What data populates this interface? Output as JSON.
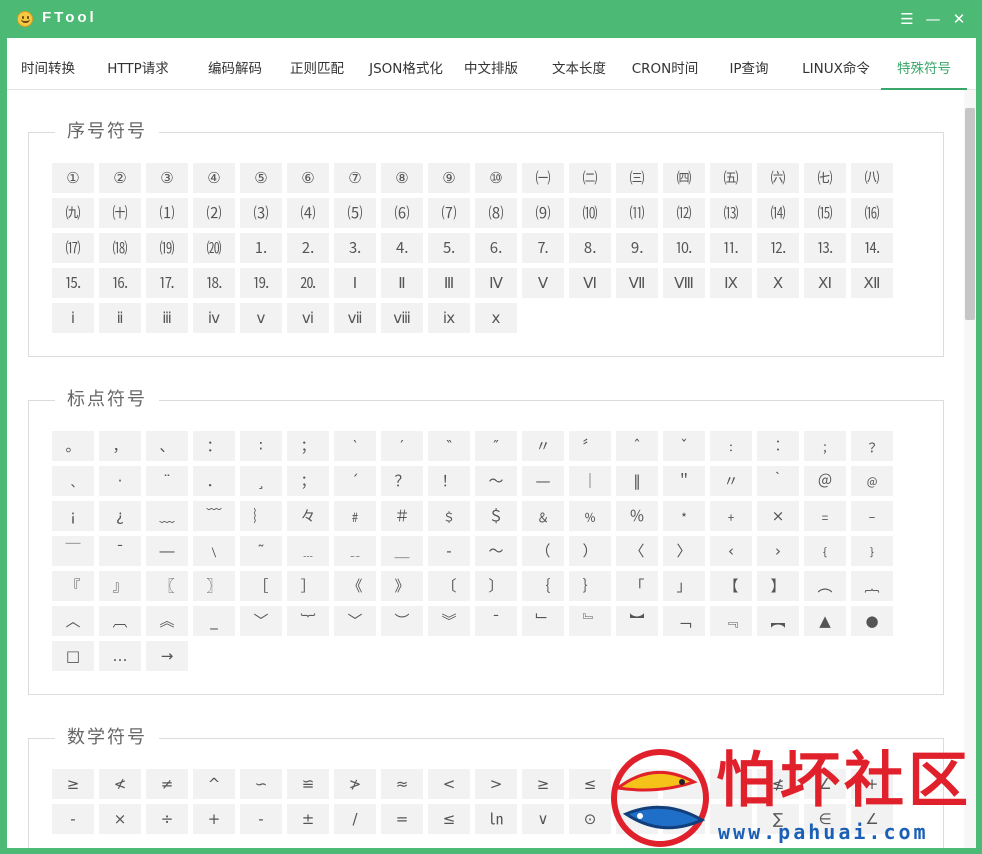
{
  "window": {
    "title": "FTool",
    "menu_icon": "☰",
    "minimize_icon": "—",
    "close_icon": "✕"
  },
  "tabs": [
    {
      "label": "时间转换"
    },
    {
      "label": "HTTP请求"
    },
    {
      "label": "编码解码"
    },
    {
      "label": "正则匹配"
    },
    {
      "label": "JSON格式化"
    },
    {
      "label": "中文排版"
    },
    {
      "label": "文本长度"
    },
    {
      "label": "CRON时间"
    },
    {
      "label": "IP查询"
    },
    {
      "label": "LINUX命令"
    },
    {
      "label": "特殊符号",
      "active": true
    }
  ],
  "sections": [
    {
      "title": "序号符号",
      "symbols": [
        "①",
        "②",
        "③",
        "④",
        "⑤",
        "⑥",
        "⑦",
        "⑧",
        "⑨",
        "⑩",
        "㈠",
        "㈡",
        "㈢",
        "㈣",
        "㈤",
        "㈥",
        "㈦",
        "㈧",
        "㈨",
        "㈩",
        "⑴",
        "⑵",
        "⑶",
        "⑷",
        "⑸",
        "⑹",
        "⑺",
        "⑻",
        "⑼",
        "⑽",
        "⑾",
        "⑿",
        "⒀",
        "⒁",
        "⒂",
        "⒃",
        "⒄",
        "⒅",
        "⒆",
        "⒇",
        "⒈",
        "⒉",
        "⒊",
        "⒋",
        "⒌",
        "⒍",
        "⒎",
        "⒏",
        "⒐",
        "⒑",
        "⒒",
        "⒓",
        "⒔",
        "⒕",
        "⒖",
        "⒗",
        "⒘",
        "⒙",
        "⒚",
        "⒛",
        "Ⅰ",
        "Ⅱ",
        "Ⅲ",
        "Ⅳ",
        "Ⅴ",
        "Ⅵ",
        "Ⅶ",
        "Ⅷ",
        "Ⅸ",
        "Ⅹ",
        "Ⅺ",
        "Ⅻ",
        "ⅰ",
        "ⅱ",
        "ⅲ",
        "ⅳ",
        "ⅴ",
        "ⅵ",
        "ⅶ",
        "ⅷ",
        "ⅸ",
        "ⅹ"
      ]
    },
    {
      "title": "标点符号",
      "symbols": [
        "。",
        "，",
        "、",
        "：",
        "∶",
        "；",
        "‵",
        "′",
        "‶",
        "″",
        "〃",
        "〞",
        "ˆ",
        "ˇ",
        "﹕",
        "︰",
        "﹔",
        "﹖",
        "﹑",
        "·",
        "¨",
        "．",
        "¸",
        "；",
        "´",
        "？",
        "！",
        "～",
        "—",
        "｜",
        "‖",
        "＂",
        "〃",
        "｀",
        "＠",
        "﹫",
        "¡",
        "¿",
        "﹏",
        "﹋",
        "︴",
        "々",
        "﹟",
        "＃",
        "﹩",
        "＄",
        "﹠",
        "﹪",
        "％",
        "﹡",
        "﹢",
        "×",
        "﹦",
        "﹣",
        "￣",
        "¯",
        "―",
        "﹨",
        "˜",
        "﹍",
        "﹎",
        "＿",
        "-",
        "～",
        "（",
        "）",
        "〈",
        "〉",
        "‹",
        "›",
        "﹛",
        "﹜",
        "『",
        "』",
        "〖",
        "〗",
        "［",
        "］",
        "《",
        "》",
        "〔",
        "〕",
        "｛",
        "｝",
        "「",
        "」",
        "【",
        "】",
        "︵",
        "︷",
        "︿",
        "︹",
        "︽",
        "_",
        "﹀",
        "︸",
        "﹀",
        "︶",
        "︾",
        "ˉ",
        "﹂",
        "﹄",
        "︼",
        "﹁",
        "﹃",
        "︻",
        "▲",
        "●",
        "□",
        "…",
        "→"
      ]
    },
    {
      "title": "数学符号",
      "symbols": [
        "≥",
        "≮",
        "≠",
        "^",
        "∽",
        "≌",
        "≯",
        "≈",
        "<",
        ">",
        "≥",
        "≤",
        "",
        "",
        "",
        "≰",
        "∠",
        "+",
        "-",
        "×",
        "÷",
        "+",
        "-",
        "±",
        "/",
        "=",
        "≤",
        "㏑",
        "∨",
        "⊙",
        "",
        "",
        "",
        "∑",
        "∈",
        "∠"
      ]
    }
  ],
  "watermark": {
    "text": "怕坏社区",
    "url": "www.pahuai.com"
  }
}
